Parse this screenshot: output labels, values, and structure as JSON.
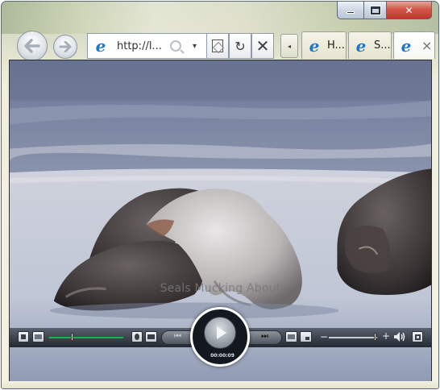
{
  "window": {
    "caption": {
      "minimize_icon": "minimize-icon",
      "maximize_icon": "maximize-icon",
      "close_label": "✕",
      "close_color": "#c9412f"
    }
  },
  "nav": {
    "back_icon": "back-arrow-icon",
    "forward_icon": "forward-arrow-icon",
    "address_text": "http://l...",
    "dropdown_glyph": "▾",
    "refresh_glyph": "↻",
    "stop_glyph": "✕"
  },
  "tabs": {
    "scroll_glyph": "◂",
    "items": [
      {
        "label": "H..."
      },
      {
        "label": "S..."
      },
      {
        "label": "",
        "close_glyph": "×"
      }
    ],
    "ie_glyph": "e"
  },
  "player": {
    "title": "Seals Mucking About",
    "time": "00:00:09",
    "position_fraction": 0.3,
    "volume_fraction": 0.95,
    "vol_minus": "−",
    "vol_plus": "+",
    "prev_glyph": "⏮",
    "next_glyph": "⏭",
    "accent": "#18b648"
  }
}
